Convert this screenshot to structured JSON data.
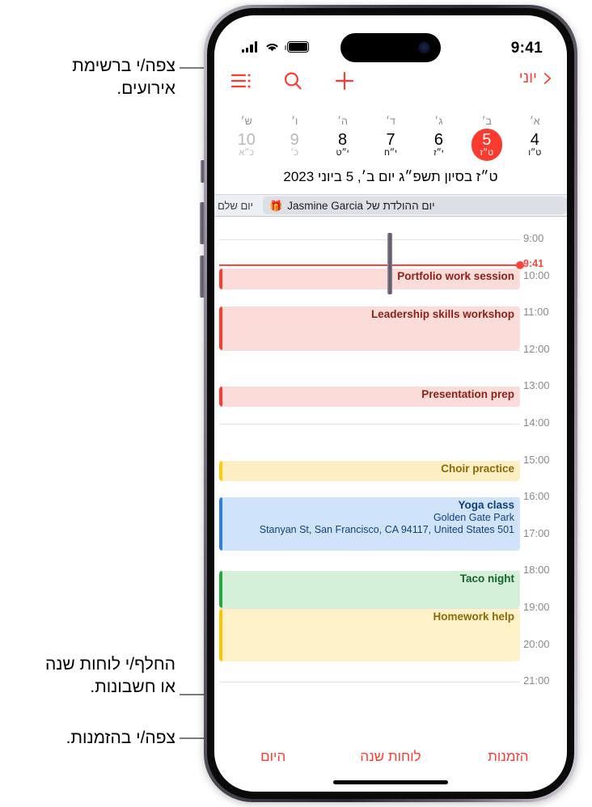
{
  "annotations": [
    {
      "id": "list-view",
      "text": "צפה/י ברשימת\nאירועים."
    },
    {
      "id": "calendars",
      "text": "החלף/י לוחות שנה\nאו חשבונות."
    },
    {
      "id": "inbox",
      "text": "צפה/י בהזמנות."
    }
  ],
  "status_bar": {
    "time": "9:41",
    "battery_icon": "battery-icon",
    "wifi_icon": "wifi-icon",
    "cellular_icon": "cellular-bars-icon"
  },
  "nav_bar": {
    "back_label": "יוני",
    "back_chevron_icon": "chevron-forward-icon",
    "add_icon": "plus-icon",
    "search_icon": "search-icon",
    "list_icon": "list-bullet-icon"
  },
  "week_strip": {
    "days": [
      {
        "dow": "א׳",
        "num": "4",
        "heb": "ט״ו",
        "today": false,
        "dim": false
      },
      {
        "dow": "ב׳",
        "num": "5",
        "heb": "ט״ז",
        "today": true,
        "dim": false
      },
      {
        "dow": "ג׳",
        "num": "6",
        "heb": "י״ז",
        "today": false,
        "dim": false
      },
      {
        "dow": "ד׳",
        "num": "7",
        "heb": "י״ח",
        "today": false,
        "dim": false
      },
      {
        "dow": "ה׳",
        "num": "8",
        "heb": "י״ט",
        "today": false,
        "dim": false
      },
      {
        "dow": "ו׳",
        "num": "9",
        "heb": "כ׳",
        "today": false,
        "dim": true
      },
      {
        "dow": "ש׳",
        "num": "10",
        "heb": "כ״א",
        "today": false,
        "dim": true
      }
    ],
    "full_date": "ט״ז בסיון תשפ״ג  יום ב׳, 5 ביוני 2023"
  },
  "all_day": {
    "label": "יום שלם",
    "gift_icon": "gift-icon",
    "event_title": "יום ההולדת של Jasmine Garcia"
  },
  "day_grid": {
    "hours": [
      "9:00",
      "10:00",
      "11:00",
      "12:00",
      "13:00",
      "14:00",
      "15:00",
      "16:00",
      "17:00",
      "18:00",
      "19:00",
      "20:00",
      "21:00"
    ],
    "now_label": "9:41",
    "events": [
      {
        "title": "Portfolio work session",
        "location": "",
        "address": "",
        "start": 9.8,
        "end": 10.35,
        "bg": "#fbdcd9",
        "bar": "#ff3b30",
        "fg": "#8c1f18"
      },
      {
        "title": "Leadership skills workshop",
        "location": "",
        "address": "",
        "start": 10.82,
        "end": 12.0,
        "bg": "#fbdcd9",
        "bar": "#ff3b30",
        "fg": "#8c1f18"
      },
      {
        "title": "Presentation prep",
        "location": "",
        "address": "",
        "start": 13.0,
        "end": 13.55,
        "bg": "#fbdcd9",
        "bar": "#ff3b30",
        "fg": "#8c1f18"
      },
      {
        "title": "Choir practice",
        "location": "",
        "address": "",
        "start": 15.0,
        "end": 15.55,
        "bg": "#fdeec4",
        "bar": "#ffcc00",
        "fg": "#8a6a08"
      },
      {
        "title": "Yoga class",
        "location": "Golden Gate Park",
        "address": "501 Stanyan St, San Francisco, CA 94117, United States",
        "start": 16.0,
        "end": 17.45,
        "bg": "#cfe4fb",
        "bar": "#2a7fe8",
        "fg": "#12407a"
      },
      {
        "title": "Taco night",
        "location": "",
        "address": "",
        "start": 18.0,
        "end": 19.0,
        "bg": "#d5f0d9",
        "bar": "#1fac3c",
        "fg": "#17642b"
      },
      {
        "title": "Homework help",
        "location": "",
        "address": "",
        "start": 19.02,
        "end": 20.45,
        "bg": "#fdf1c8",
        "bar": "#ffc400",
        "fg": "#8a6a08"
      }
    ]
  },
  "toolbar": {
    "items": [
      {
        "id": "today",
        "label": "היום"
      },
      {
        "id": "calendars",
        "label": "לוחות שנה"
      },
      {
        "id": "inbox",
        "label": "הזמנות"
      }
    ]
  },
  "colors": {
    "accent": "#ff3b30",
    "today_circle": "#fb3b30",
    "leader_line": "#7c7c7c"
  }
}
